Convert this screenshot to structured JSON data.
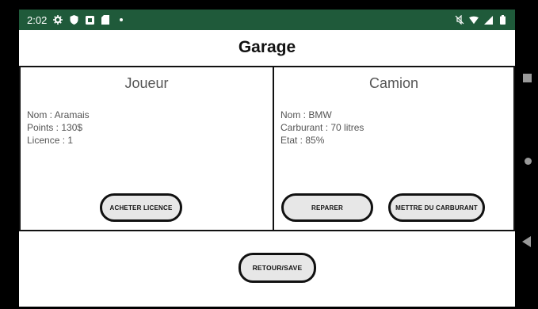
{
  "status_bar": {
    "time": "2:02",
    "left_icons": [
      "gear-icon",
      "shield-icon",
      "square-notification-icon",
      "sd-card-icon",
      "dot-icon"
    ],
    "right_icons": [
      "mute-icon",
      "wifi-icon",
      "signal-icon",
      "battery-icon"
    ],
    "background": "#1f5a3a"
  },
  "app": {
    "title": "Garage"
  },
  "joueur": {
    "heading": "Joueur",
    "nom": "Nom : Aramais",
    "points": "Points : 130$",
    "licence": "Licence : 1",
    "buy_licence_label": "ACHETER LICENCE"
  },
  "camion": {
    "heading": "Camion",
    "nom": "Nom : BMW",
    "carburant": "Carburant : 70 litres",
    "etat": "Etat : 85%",
    "repair_label": "REPARER",
    "fuel_label": "METTRE DU CARBURANT"
  },
  "footer": {
    "back_label": "RETOUR/SAVE"
  },
  "nav_bar": {
    "icons": [
      "recents-icon",
      "home-icon",
      "back-icon"
    ]
  }
}
